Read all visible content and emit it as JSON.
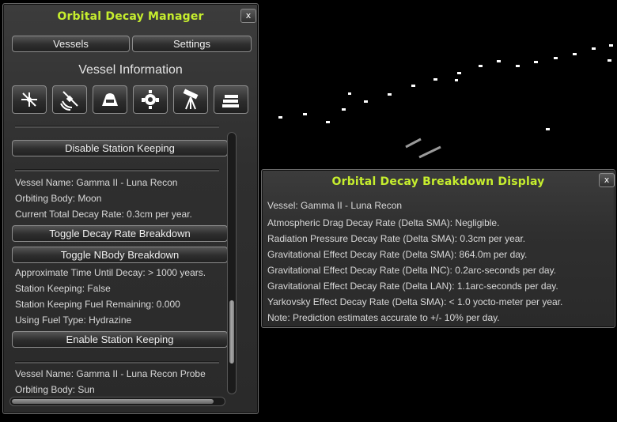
{
  "manager": {
    "title": "Orbital Decay Manager",
    "close_label": "x",
    "tabs": {
      "vessels": "Vessels",
      "settings": "Settings"
    },
    "heading": "Vessel Information",
    "buttons": {
      "disable_station_keeping": "Disable Station Keeping",
      "toggle_decay_breakdown": "Toggle Decay Rate Breakdown",
      "toggle_nbody_breakdown": "Toggle NBody Breakdown",
      "enable_station_keeping": "Enable Station Keeping"
    },
    "vessel1": {
      "name": "Vessel Name: Gamma II - Luna Recon",
      "body": "Orbiting Body: Moon",
      "decay_rate": "Current Total Decay Rate: 0.3cm per year.",
      "time_until_decay": "Approximate Time Until Decay: > 1000 years.",
      "station_keeping": "Station Keeping: False",
      "fuel_remaining": "Station Keeping Fuel Remaining: 0.000",
      "fuel_type": "Using Fuel Type: Hydrazine"
    },
    "vessel2": {
      "name": "Vessel Name: Gamma II - Luna Recon Probe",
      "body": "Orbiting Body: Sun"
    }
  },
  "breakdown": {
    "title": "Orbital Decay Breakdown Display",
    "close_label": "x",
    "lines": [
      "Vessel: Gamma II - Luna Recon",
      "Atmospheric Drag Decay Rate (Delta SMA): Negligible.",
      "Radiation Pressure Decay Rate (Delta SMA): 0.3cm per year.",
      "Gravitational Effect Decay Rate (Delta SMA): 864.0m per day.",
      "Gravitational Effect Decay Rate (Delta INC): 0.2arc-seconds per day.",
      "Gravitational Effect Decay Rate (Delta LAN): 1.1arc-seconds per day.",
      "Yarkovsky Effect Decay Rate (Delta SMA): < 1.0 yocto-meter per year.",
      "Note: Prediction estimates accurate to +/- 10% per day."
    ]
  },
  "colors": {
    "title_accent": "#c6ee2e",
    "panel_bg": "#2f2f2f"
  },
  "icons": [
    "satellite-icon",
    "satellite-dish-icon",
    "capsule-icon",
    "probe-core-icon",
    "telescope-icon",
    "book-stack-icon"
  ]
}
